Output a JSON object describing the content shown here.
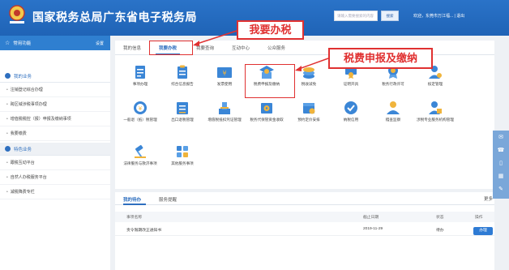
{
  "header": {
    "title": "国家税务总局广东省电子税务局",
    "search_placeholder": "请输入需要搜索的内容",
    "search_button": "搜索",
    "user_info": "欢迎，东莞市万江福...  |  退出"
  },
  "sidebar": {
    "common_functions": "常用功能",
    "settings": "设置",
    "category1": "我的业务",
    "items1": [
      "注销登记综合办理",
      "跨区域涉税事项办理",
      "增值税税控（报）申报及缴纳事项",
      "我要缴费"
    ],
    "category2": "特色业务",
    "items2": [
      "跟税互动平台",
      "自然人办税服务平台",
      "减税降费专栏"
    ]
  },
  "tabs": [
    "我的信息",
    "我要办税",
    "我要查询",
    "互动中心",
    "公众服务"
  ],
  "grid": [
    {
      "label": "事项办理",
      "icon": "doc-icon"
    },
    {
      "label": "综合信息报告",
      "icon": "clipboard-icon"
    },
    {
      "label": "发票使用",
      "icon": "invoice-icon"
    },
    {
      "label": "税费申报及缴纳",
      "icon": "tax-declare-icon"
    },
    {
      "label": "税收减免",
      "icon": "coins-icon"
    },
    {
      "label": "证明开具",
      "icon": "certificate-icon"
    },
    {
      "label": "税务行政许可",
      "icon": "badge-icon"
    },
    {
      "label": "核定管理",
      "icon": "person-check-icon"
    },
    {
      "label": "一般退（抵）税管理",
      "icon": "refund-icon"
    },
    {
      "label": "出口退税管理",
      "icon": "export-icon"
    },
    {
      "label": "增值税抵扣凭证管理",
      "icon": "stamp-icon"
    },
    {
      "label": "税务代保管资金收取",
      "icon": "safe-icon"
    },
    {
      "label": "预约定价安排",
      "icon": "calendar-icon"
    },
    {
      "label": "纳税信用",
      "icon": "credit-icon"
    },
    {
      "label": "稽查监察",
      "icon": "inspect-icon"
    },
    {
      "label": "涉税专业服务机构管理",
      "icon": "agency-icon"
    },
    {
      "label": "法律服务与救济事项",
      "icon": "gavel-icon"
    },
    {
      "label": "其他服务事项",
      "icon": "other-icon"
    }
  ],
  "bottom": {
    "tab_todo": "我的待办",
    "tab_reminder": "服务提醒",
    "more": "更多",
    "columns": [
      "事项名称",
      "截止日期",
      "状态",
      "操作"
    ],
    "rows": [
      {
        "name": "责令限期改正通知书",
        "deadline": "2019-11-29",
        "status": "待办",
        "action": "办理"
      }
    ]
  },
  "annotations": {
    "callout1": "我要办税",
    "callout2": "税费申报及缴纳"
  },
  "colors": {
    "header_blue": "#2a73c8",
    "accent": "#2e6fbf",
    "annotation_red": "#e03131"
  }
}
